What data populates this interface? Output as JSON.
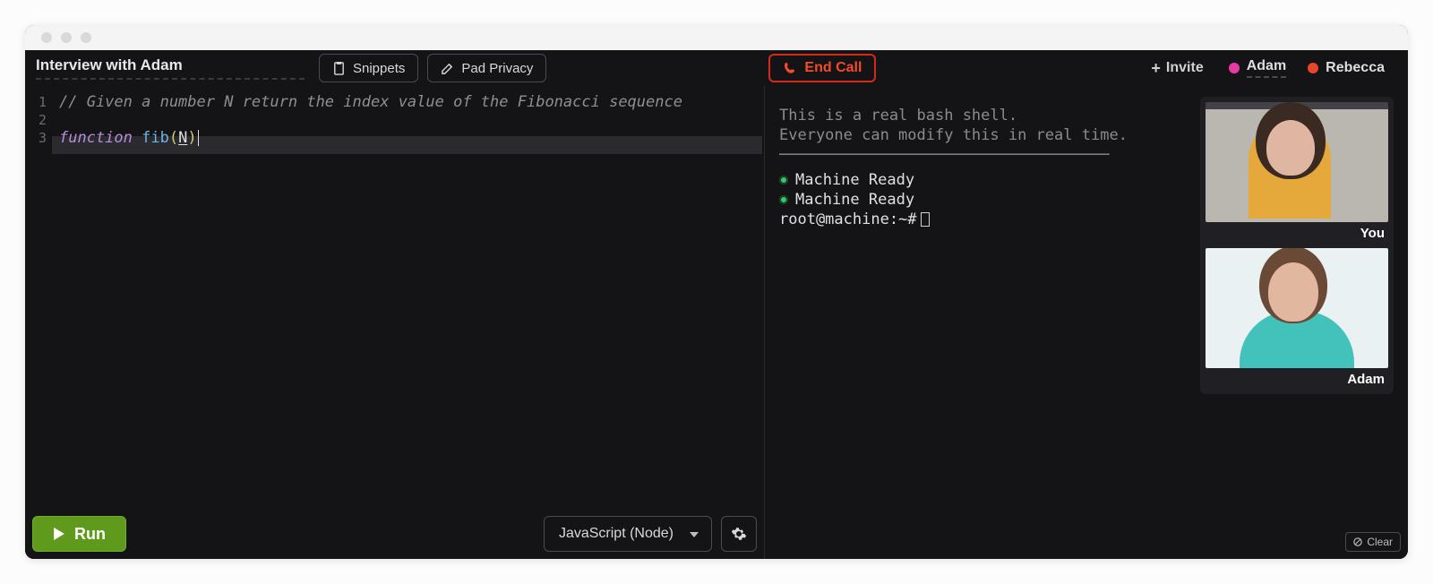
{
  "header": {
    "title": "Interview with Adam",
    "snippets_label": "Snippets",
    "privacy_label": "Pad Privacy",
    "end_call_label": "End Call",
    "invite_label": "Invite"
  },
  "participants": [
    {
      "name": "Adam",
      "color": "#e83aa7",
      "underline": true
    },
    {
      "name": "Rebecca",
      "color": "#e8452a",
      "underline": false
    }
  ],
  "editor": {
    "gutter": [
      "1",
      "2",
      "3"
    ],
    "line1_comment": "// Given a number N return the index value of the Fibonacci sequence",
    "line3_keyword": "function",
    "line3_fn": "fib",
    "line3_paren_open": "(",
    "line3_param": "N",
    "line3_paren_close": ")"
  },
  "footer": {
    "run_label": "Run",
    "language_label": "JavaScript (Node)"
  },
  "terminal": {
    "intro1": "This is a real bash shell.",
    "intro2": "Everyone can modify this in real time.",
    "hr": "────────────────────────────────────",
    "status1": "Machine Ready",
    "status2": "Machine Ready",
    "prompt": "root@machine:~#"
  },
  "video": {
    "tile1_label": "You",
    "tile2_label": "Adam"
  },
  "clear_label": "Clear"
}
